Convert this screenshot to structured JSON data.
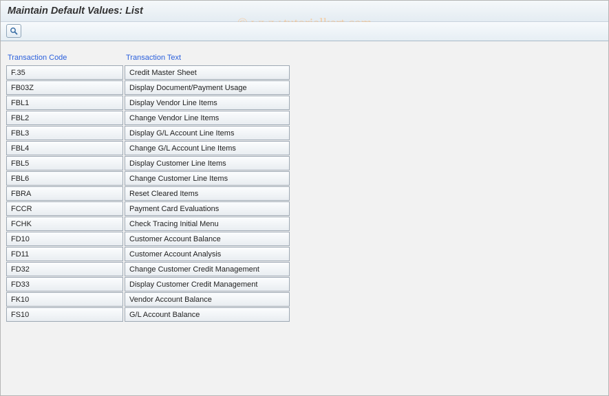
{
  "window": {
    "title": "Maintain Default Values: List"
  },
  "watermark": "© www.tutorialkart.com",
  "toolbar": {
    "choose_icon": "choose-icon"
  },
  "table": {
    "headers": {
      "code": "Transaction Code",
      "text": "Transaction Text"
    },
    "rows": [
      {
        "code": "F.35",
        "text": "Credit Master Sheet"
      },
      {
        "code": "FB03Z",
        "text": "Display Document/Payment Usage"
      },
      {
        "code": "FBL1",
        "text": "Display Vendor Line Items"
      },
      {
        "code": "FBL2",
        "text": "Change Vendor Line Items"
      },
      {
        "code": "FBL3",
        "text": "Display G/L Account Line Items"
      },
      {
        "code": "FBL4",
        "text": "Change G/L Account Line Items"
      },
      {
        "code": "FBL5",
        "text": "Display Customer Line Items"
      },
      {
        "code": "FBL6",
        "text": "Change Customer Line Items"
      },
      {
        "code": "FBRA",
        "text": "Reset Cleared Items"
      },
      {
        "code": "FCCR",
        "text": "Payment Card Evaluations"
      },
      {
        "code": "FCHK",
        "text": "Check Tracing Initial Menu"
      },
      {
        "code": "FD10",
        "text": "Customer Account Balance"
      },
      {
        "code": "FD11",
        "text": "Customer Account Analysis"
      },
      {
        "code": "FD32",
        "text": "Change Customer Credit Management"
      },
      {
        "code": "FD33",
        "text": "Display Customer Credit Management"
      },
      {
        "code": "FK10",
        "text": "Vendor Account Balance"
      },
      {
        "code": "FS10",
        "text": "G/L Account Balance"
      }
    ]
  }
}
